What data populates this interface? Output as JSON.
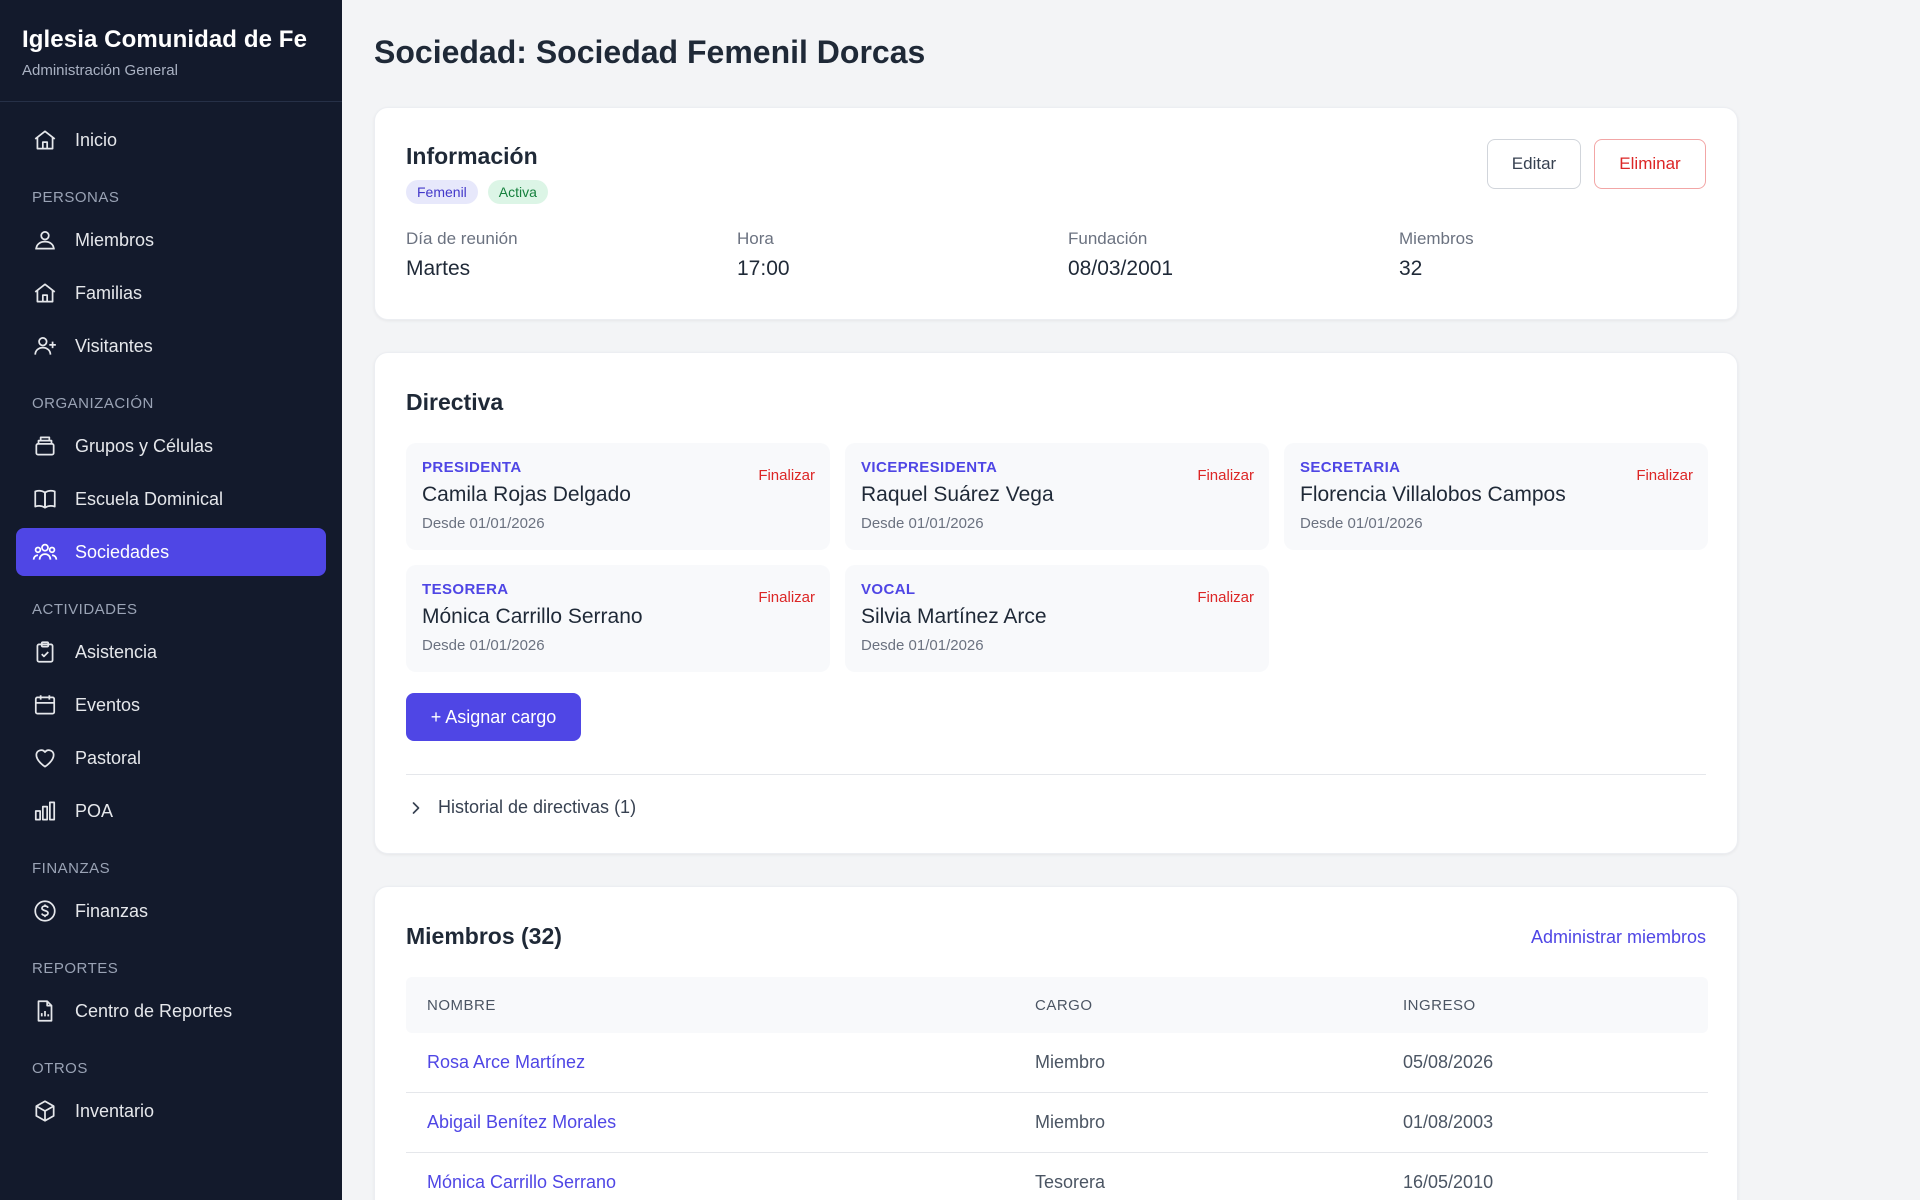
{
  "sidebar": {
    "brand_title": "Iglesia Comunidad de Fe",
    "brand_sub": "Administración General",
    "inicio": "Inicio",
    "sections": {
      "personas": "PERSONAS",
      "organizacion": "ORGANIZACIÓN",
      "actividades": "ACTIVIDADES",
      "finanzas": "FINANZAS",
      "reportes": "REPORTES",
      "otros": "OTROS"
    },
    "items": {
      "miembros": "Miembros",
      "familias": "Familias",
      "visitantes": "Visitantes",
      "grupos": "Grupos y Células",
      "escuela": "Escuela Dominical",
      "sociedades": "Sociedades",
      "asistencia": "Asistencia",
      "eventos": "Eventos",
      "pastoral": "Pastoral",
      "poa": "POA",
      "finanzas": "Finanzas",
      "reportes": "Centro de Reportes",
      "inventario": "Inventario"
    },
    "active": "sociedades",
    "accent": "#4f46e5"
  },
  "page": {
    "title": "Sociedad: Sociedad Femenil Dorcas"
  },
  "info": {
    "title": "Información",
    "badges": [
      "Femenil",
      "Activa"
    ],
    "edit_label": "Editar",
    "delete_label": "Eliminar",
    "fields": [
      {
        "label": "Día de reunión",
        "value": "Martes"
      },
      {
        "label": "Hora",
        "value": "17:00"
      },
      {
        "label": "Fundación",
        "value": "08/03/2001"
      },
      {
        "label": "Miembros",
        "value": "32"
      }
    ]
  },
  "directiva": {
    "title": "Directiva",
    "end_label": "Finalizar",
    "roles": [
      {
        "role": "PRESIDENTA",
        "person": "Camila Rojas Delgado",
        "since": "Desde 01/01/2026"
      },
      {
        "role": "VICEPRESIDENTA",
        "person": "Raquel Suárez Vega",
        "since": "Desde 01/01/2026"
      },
      {
        "role": "SECRETARIA",
        "person": "Florencia Villalobos Campos",
        "since": "Desde 01/01/2026"
      },
      {
        "role": "TESORERA",
        "person": "Mónica Carrillo Serrano",
        "since": "Desde 01/01/2026"
      },
      {
        "role": "VOCAL",
        "person": "Silvia Martínez Arce",
        "since": "Desde 01/01/2026"
      }
    ],
    "assign_label": "+ Asignar cargo",
    "history_label": "Historial de directivas (1)"
  },
  "members": {
    "title": "Miembros (32)",
    "manage_label": "Administrar miembros",
    "columns": [
      "NOMBRE",
      "CARGO",
      "INGRESO"
    ],
    "rows": [
      {
        "name": "Rosa Arce Martínez",
        "role": "Miembro",
        "joined": "05/08/2026"
      },
      {
        "name": "Abigail Benítez Morales",
        "role": "Miembro",
        "joined": "01/08/2003"
      },
      {
        "name": "Mónica Carrillo Serrano",
        "role": "Tesorera",
        "joined": "16/05/2010"
      }
    ]
  }
}
